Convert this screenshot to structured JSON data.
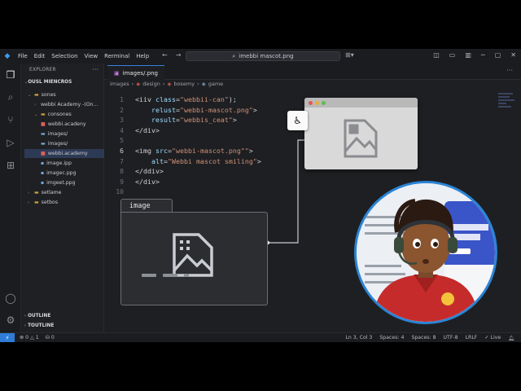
{
  "app": {
    "menu": [
      "File",
      "Edit",
      "Selection",
      "View",
      "Rerminal",
      "Help"
    ],
    "command_center": "imebbi mascot.png"
  },
  "sidebar": {
    "title": "EXPLORER",
    "section": "OUSL MIENCROS",
    "items": [
      {
        "label": "sones",
        "kind": "folder",
        "depth": 1,
        "expanded": true
      },
      {
        "label": "webbi Academy -(On...",
        "kind": "folder",
        "depth": 2,
        "expanded": false
      },
      {
        "label": "consones",
        "kind": "folder",
        "depth": 2,
        "expanded": true
      },
      {
        "label": "webbi.acadeny",
        "kind": "file-red",
        "depth": 3
      },
      {
        "label": "images/",
        "kind": "folder-blue",
        "depth": 3
      },
      {
        "label": "images/",
        "kind": "folder-blue",
        "depth": 3
      },
      {
        "label": "webbi.academy",
        "kind": "file-red",
        "depth": 3,
        "selected": true
      },
      {
        "label": "image.ipp",
        "kind": "file",
        "depth": 2
      },
      {
        "label": "imagec.ppg",
        "kind": "file",
        "depth": 2
      },
      {
        "label": "imgeet.ppg",
        "kind": "file",
        "depth": 2
      },
      {
        "label": "setlame",
        "kind": "folder",
        "depth": 1,
        "expanded": false
      },
      {
        "label": "setbos",
        "kind": "folder",
        "depth": 1,
        "expanded": false
      }
    ],
    "outline": "OUTLINE",
    "timeline": "TOUTLINE"
  },
  "tabs": [
    {
      "label": "images/.png",
      "active": true
    }
  ],
  "breadcrumb": [
    "images",
    "design",
    "bosemy",
    "game"
  ],
  "editor": {
    "lines": [
      {
        "n": "1",
        "parts": [
          [
            "t",
            "<iiv "
          ],
          [
            "a",
            "class"
          ],
          [
            "t",
            "="
          ],
          [
            "s",
            "\"webbii-can\""
          ],
          [
            "t",
            ");"
          ]
        ]
      },
      {
        "n": "2",
        "indent": true,
        "parts": [
          [
            "a",
            "relust"
          ],
          [
            "t",
            "="
          ],
          [
            "s",
            "\"webbi-mascot.png\""
          ],
          [
            "t",
            ">"
          ]
        ]
      },
      {
        "n": "3",
        "indent": true,
        "parts": [
          [
            "a",
            "result"
          ],
          [
            "t",
            "="
          ],
          [
            "s",
            "\"webbis_ceat\""
          ],
          [
            "t",
            ">"
          ]
        ]
      },
      {
        "n": "4",
        "parts": [
          [
            "t",
            "</div>"
          ]
        ]
      },
      {
        "n": "5",
        "parts": [
          [
            "t",
            ""
          ]
        ]
      },
      {
        "n": "6",
        "parts": [
          [
            "t",
            "<img "
          ],
          [
            "a",
            "src"
          ],
          [
            "t",
            "="
          ],
          [
            "s",
            "\"webbi-mascot.png\"\""
          ],
          [
            "t",
            ">"
          ]
        ]
      },
      {
        "n": "7",
        "indent": true,
        "parts": [
          [
            "a",
            "alt"
          ],
          [
            "t",
            "="
          ],
          [
            "s",
            "\"Webbi mascot smiling\""
          ],
          [
            "t",
            ">"
          ]
        ]
      },
      {
        "n": "8",
        "parts": [
          [
            "t",
            "</ddiv>"
          ]
        ]
      },
      {
        "n": "9",
        "parts": [
          [
            "t",
            "</div>"
          ]
        ]
      },
      {
        "n": "10",
        "parts": [
          [
            "t",
            ""
          ]
        ]
      }
    ],
    "current_line": "6"
  },
  "overlay": {
    "folder_label": "image"
  },
  "status": {
    "errors": "0",
    "warnings": "1",
    "ports": "0",
    "position": "Ln 3, Col 3",
    "spaces1": "Spaces: 4",
    "spaces2": "Spaces: 8",
    "encoding": "UTF-8",
    "eol": "LRLF",
    "live": "Live"
  },
  "colors": {
    "accent": "#2f7bd8",
    "popup_dot_red": "#e8574f",
    "popup_dot_yellow": "#e6b03a",
    "popup_dot_green": "#5cbf4a"
  }
}
